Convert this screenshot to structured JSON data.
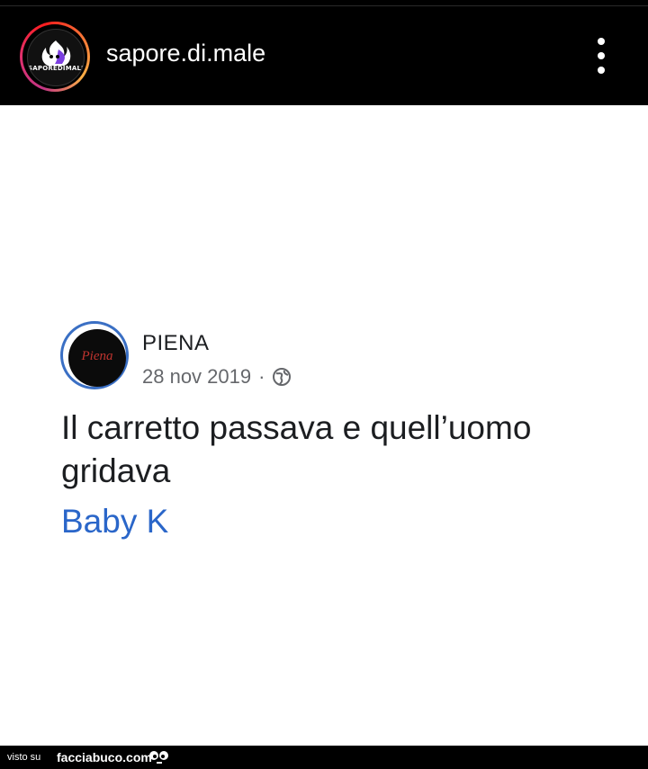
{
  "header": {
    "username": "sapore.di.male",
    "avatar_text": "SAPOREDIMALE"
  },
  "post": {
    "author": "PIENA",
    "avatar_text": "Piena",
    "date": "28 nov 2019",
    "separator": "·",
    "text": "Il carretto passava e quell’uomo gridava",
    "tag": "Baby K"
  },
  "footer": {
    "visto": "visto su",
    "brand": "facciabuco.com"
  },
  "colors": {
    "top_bar": "#000000",
    "link_blue": "#2a66c9",
    "meta_gray": "#65676b"
  },
  "icons": [
    "more-vert-icon",
    "globe-icon",
    "facciabuco-eyes-icon"
  ]
}
